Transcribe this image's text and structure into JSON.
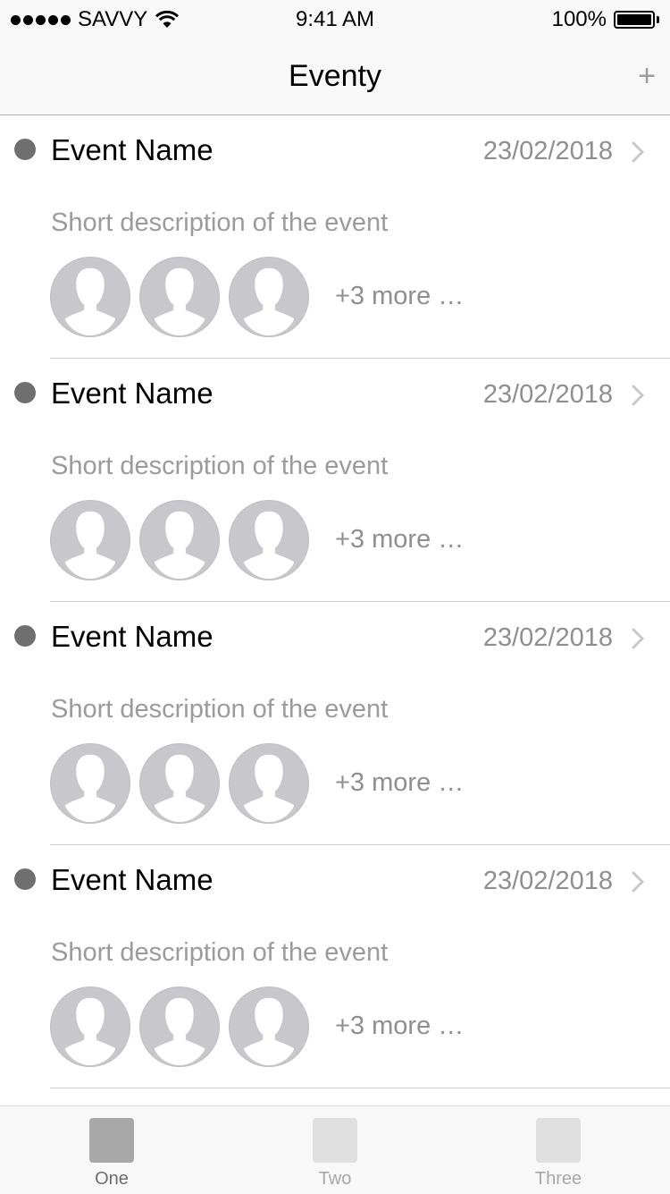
{
  "status_bar": {
    "carrier": "SAVVY",
    "time": "9:41 AM",
    "battery": "100%"
  },
  "nav": {
    "title": "Eventy",
    "add_label": "+"
  },
  "events": [
    {
      "name": "Event Name",
      "date": "23/02/2018",
      "description": "Short description of the event",
      "more": "+3 more …"
    },
    {
      "name": "Event Name",
      "date": "23/02/2018",
      "description": "Short description of the event",
      "more": "+3 more …"
    },
    {
      "name": "Event Name",
      "date": "23/02/2018",
      "description": "Short description of the event",
      "more": "+3 more …"
    },
    {
      "name": "Event Name",
      "date": "23/02/2018",
      "description": "Short description of the event",
      "more": "+3 more …"
    }
  ],
  "tabs": [
    {
      "label": "One",
      "selected": true
    },
    {
      "label": "Two",
      "selected": false
    },
    {
      "label": "Three",
      "selected": false
    }
  ],
  "colors": {
    "selected_tab_icon": "#a8a8a8",
    "unselected_tab_icon": "#e0e0e0",
    "selected_tab_label": "#6d6d6d",
    "unselected_tab_label": "#a8a8a8",
    "status_dot": "#6f6f6f",
    "avatar_bg": "#c8c7cc"
  }
}
